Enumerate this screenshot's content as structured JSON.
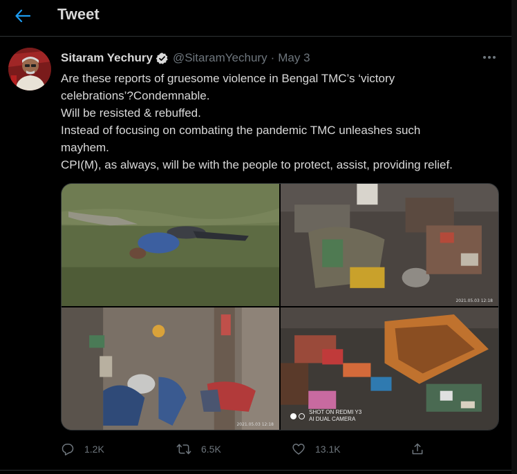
{
  "header": {
    "title": "Tweet"
  },
  "tweet": {
    "author_name": "Sitaram Yechury",
    "handle": "@SitaramYechury",
    "separator": "·",
    "date": "May 3",
    "lines": [
      "Are these reports of gruesome violence in Bengal TMC’s ‘victory",
      "celebrations’?Condemnable.",
      "Will be resisted & rebuffed.",
      "Instead of focusing on combating the pandemic TMC unleashes such",
      "mayhem.",
      "CPI(M), as always, will be with the people to protect, assist, providing relief."
    ],
    "photos": {
      "p2_stamp": "2021.05.03 12:18",
      "p3_stamp": "2021.05.03 12:18",
      "p4_cam_line1": "SHOT ON REDMI Y3",
      "p4_cam_line2": "AI DUAL CAMERA"
    }
  },
  "actions": {
    "replies": "1.2K",
    "retweets": "6.5K",
    "likes": "13.1K"
  },
  "colors": {
    "background": "#000000",
    "text": "#d9d9d9",
    "secondary": "#6e767d",
    "accent": "#1d9bf0",
    "border": "#2f3336"
  },
  "icons": [
    "back-arrow-icon",
    "verified-badge-icon",
    "more-icon",
    "reply-icon",
    "retweet-icon",
    "like-icon",
    "share-icon"
  ]
}
